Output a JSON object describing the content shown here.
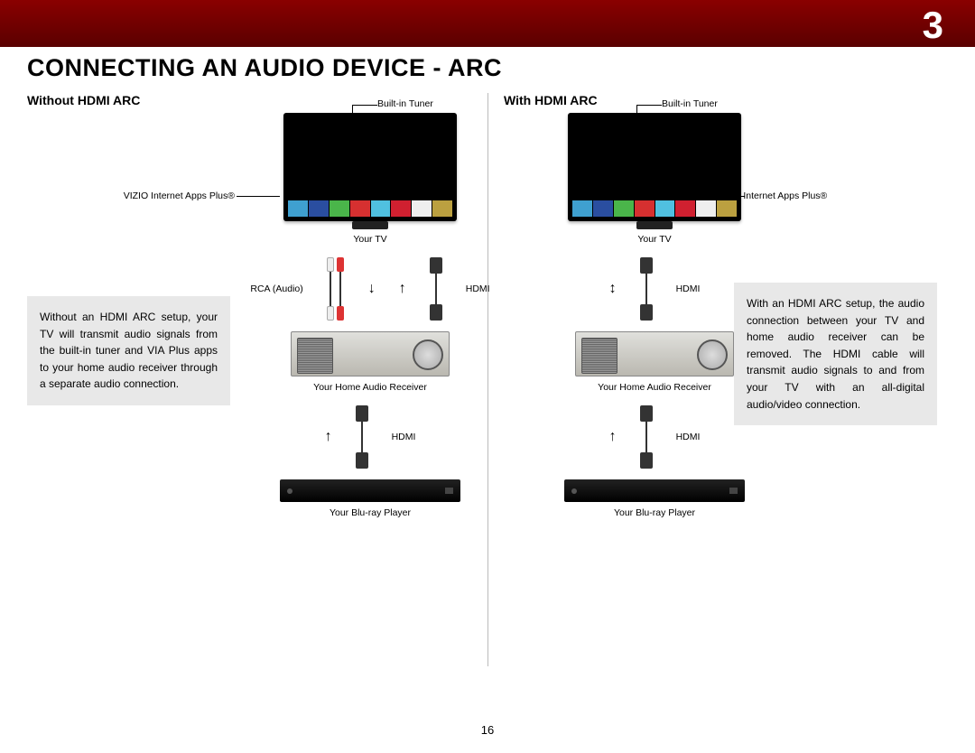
{
  "chapter": "3",
  "title": "CONNECTING AN AUDIO DEVICE - ARC",
  "page_number": "16",
  "left": {
    "title": "Without HDMI ARC",
    "info": "Without an HDMI ARC setup, your TV will transmit audio signals from the built-in tuner and VIA Plus apps to your home audio receiver through a separate audio connection.",
    "tuner_label": "Built-in Tuner",
    "via_label": "VIZIO Internet Apps Plus®",
    "tv_label": "Your TV",
    "rca_label": "RCA (Audio)",
    "hdmi_label": "HDMI",
    "receiver_label": "Your Home Audio Receiver",
    "hdmi2_label": "HDMI",
    "bluray_label": "Your Blu-ray Player"
  },
  "right": {
    "title": "With HDMI ARC",
    "info": "With an HDMI ARC setup, the audio connection between your TV and home audio receiver can be removed. The HDMI cable will transmit audio signals to and from your TV with an all-digital audio/video connection.",
    "tuner_label": "Built-in Tuner",
    "via_label": "VIZIO Internet Apps Plus®",
    "tv_label": "Your TV",
    "hdmi_label": "HDMI",
    "receiver_label": "Your Home Audio Receiver",
    "hdmi2_label": "HDMI",
    "bluray_label": "Your Blu-ray Player"
  }
}
